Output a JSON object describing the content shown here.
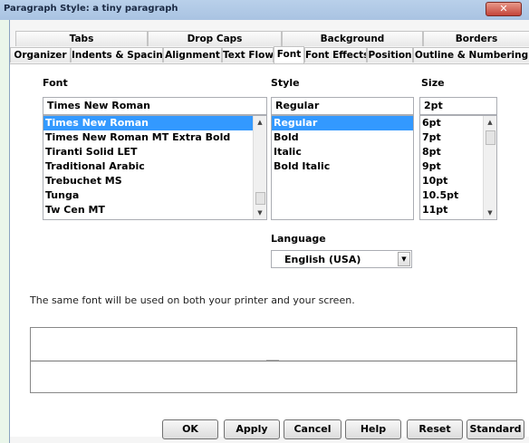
{
  "window": {
    "title": "Paragraph Style: a tiny paragraph",
    "close_glyph": "✕"
  },
  "tabs_row1": [
    "Tabs",
    "Drop Caps",
    "Background",
    "Borders"
  ],
  "tabs_row2": [
    "Organizer",
    "Indents & Spacing",
    "Alignment",
    "Text Flow",
    "Font",
    "Font Effects",
    "Position",
    "Outline & Numbering"
  ],
  "active_tab": "Font",
  "font": {
    "label": "Font",
    "value": "Times New Roman",
    "items": [
      "Times New Roman",
      "Times New Roman MT Extra Bold",
      "Tiranti Solid LET",
      "Traditional Arabic",
      "Trebuchet MS",
      "Tunga",
      "Tw Cen MT"
    ],
    "selected": "Times New Roman"
  },
  "style": {
    "label": "Style",
    "value": "Regular",
    "items": [
      "Regular",
      "Bold",
      "Italic",
      "Bold Italic"
    ],
    "selected": "Regular"
  },
  "size": {
    "label": "Size",
    "value": "2pt",
    "items": [
      "6pt",
      "7pt",
      "8pt",
      "9pt",
      "10pt",
      "10.5pt",
      "11pt"
    ]
  },
  "language": {
    "label": "Language",
    "value": "English (USA)"
  },
  "info_text": "The same font will be used on both your printer and your screen.",
  "buttons": {
    "ok": "OK",
    "apply": "Apply",
    "cancel": "Cancel",
    "help": "Help",
    "reset": "Reset",
    "standard": "Standard"
  },
  "icons": {
    "scroll_up": "▲",
    "scroll_down": "▼",
    "dropdown": "▼"
  }
}
